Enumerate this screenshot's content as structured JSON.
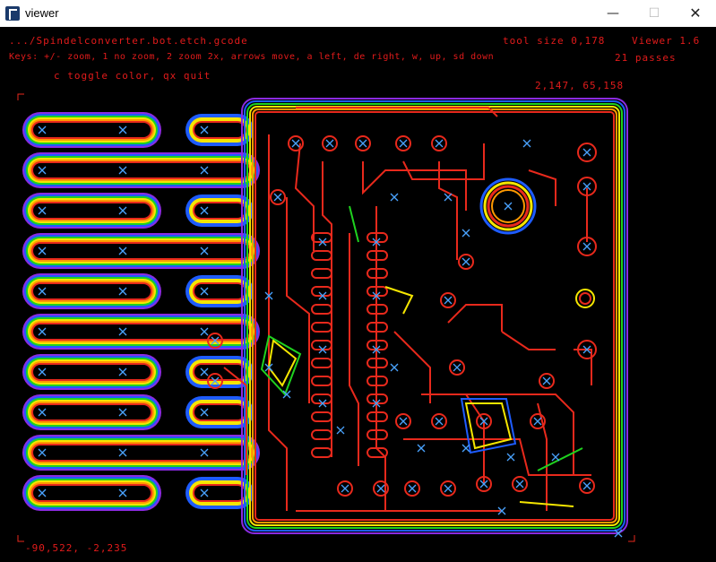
{
  "window": {
    "title": "viewer",
    "minimize": "—",
    "maximize": "☐",
    "close": "✕"
  },
  "hud": {
    "file": ".../Spindelconverter.bot.etch.gcode",
    "tool_size": "tool size 0,178",
    "version": "Viewer 1.6",
    "keys_line1": "Keys: +/- zoom, 1 no zoom, 2 zoom 2x, arrows move, a left, de right, w, up, sd down",
    "passes": "21 passes",
    "keys_line2": "c toggle color, qx quit",
    "coord_top_right": "2,147, 65,158",
    "coord_bottom_left": "-90,522, -2,235"
  },
  "colors": {
    "trace": "#e8291c",
    "pass_colors": [
      "#e8291c",
      "#ff9a00",
      "#f5e600",
      "#1fd21f",
      "#1e5cff",
      "#8a2be2"
    ],
    "marker": "#4aa3ff"
  }
}
